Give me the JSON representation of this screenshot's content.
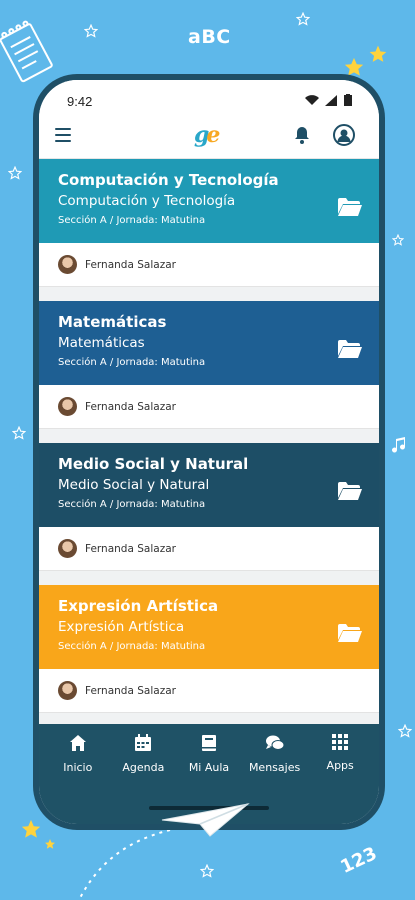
{
  "decor": {
    "top_text": "aBC",
    "bottom_text": "123"
  },
  "status": {
    "time": "9:42"
  },
  "appbar": {
    "logo_g": "g",
    "logo_e": "e"
  },
  "courses": [
    {
      "title": "Computación y Tecnología",
      "subtitle": "Computación y Tecnología",
      "section": "Sección A / Jornada: Matutina",
      "teacher": "Fernanda Salazar",
      "color": "#1f9ab5"
    },
    {
      "title": "Matemáticas",
      "subtitle": "Matemáticas",
      "section": "Sección A / Jornada: Matutina",
      "teacher": "Fernanda Salazar",
      "color": "#1e5f93"
    },
    {
      "title": "Medio Social y Natural",
      "subtitle": "Medio Social y Natural",
      "section": "Sección A / Jornada: Matutina",
      "teacher": "Fernanda Salazar",
      "color": "#1d4e66"
    },
    {
      "title": "Expresión Artística",
      "subtitle": "Expresión Artística",
      "section": "Sección A / Jornada: Matutina",
      "teacher": "Fernanda Salazar",
      "color": "#f9a61a"
    }
  ],
  "nav": [
    {
      "label": "Inicio",
      "icon": "home-icon"
    },
    {
      "label": "Agenda",
      "icon": "calendar-icon"
    },
    {
      "label": "Mi Aula",
      "icon": "book-icon"
    },
    {
      "label": "Mensajes",
      "icon": "chat-icon"
    },
    {
      "label": "Apps",
      "icon": "grid-icon"
    }
  ]
}
